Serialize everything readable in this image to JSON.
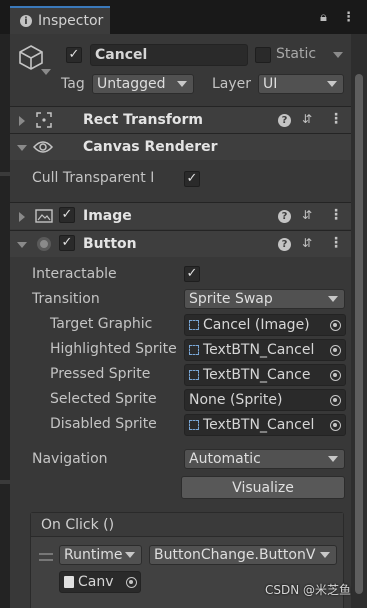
{
  "window": {
    "tab_title": "Inspector",
    "tab_icon": "info-icon",
    "lock_icon": "lock-icon",
    "menu_icon": "kebab-menu-icon"
  },
  "gameobject": {
    "active": true,
    "name": "Cancel",
    "static_label": "Static",
    "static_checked": false,
    "tag_label": "Tag",
    "tag_value": "Untagged",
    "layer_label": "Layer",
    "layer_value": "UI",
    "icon": "cube-icon"
  },
  "components": {
    "rect_transform": {
      "title": "Rect Transform",
      "expanded": false,
      "icon": "rect-transform-icon"
    },
    "canvas_renderer": {
      "title": "Canvas Renderer",
      "expanded": true,
      "icon": "eye-icon",
      "cull_label": "Cull Transparent Mes",
      "cull_checked": true
    },
    "image": {
      "title": "Image",
      "expanded": false,
      "enabled": true,
      "icon": "image-icon"
    },
    "button": {
      "title": "Button",
      "expanded": true,
      "enabled": true,
      "icon": "button-icon",
      "interactable_label": "Interactable",
      "interactable_checked": true,
      "transition_label": "Transition",
      "transition_value": "Sprite Swap",
      "target_graphic_label": "Target Graphic",
      "target_graphic_value": "Cancel (Image)",
      "highlighted_label": "Highlighted Sprite",
      "highlighted_value": "TextBTN_Cancel",
      "pressed_label": "Pressed Sprite",
      "pressed_value": "TextBTN_Cance",
      "selected_label": "Selected Sprite",
      "selected_value": "None (Sprite)",
      "disabled_label": "Disabled Sprite",
      "disabled_value": "TextBTN_Cancel",
      "navigation_label": "Navigation",
      "navigation_value": "Automatic",
      "visualize_label": "Visualize",
      "onclick": {
        "header": "On Click ()",
        "runtime_value": "Runtime",
        "function_value": "ButtonChange.ButtonV",
        "object_value": "Canv"
      }
    }
  },
  "watermark": "CSDN @米芝鱼",
  "colors": {
    "accent": "#3a79bb",
    "panel": "#383838",
    "field": "#2a2a2a"
  }
}
